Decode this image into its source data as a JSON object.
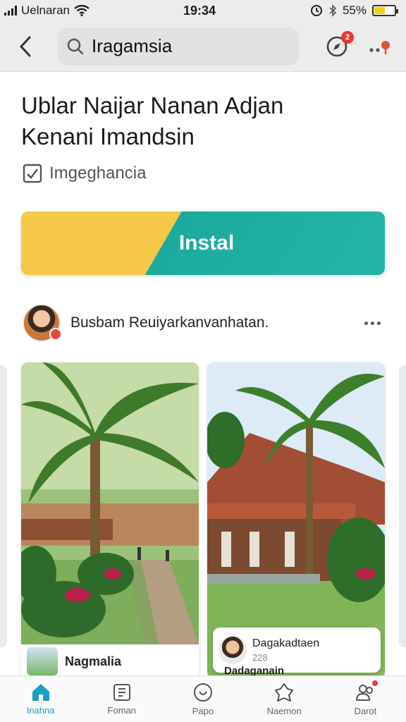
{
  "status_bar": {
    "carrier": "Uelnaran",
    "time": "19:34",
    "battery_percent": "55%",
    "battery_level": 0.55,
    "icons": [
      "signal-icon",
      "wifi-icon",
      "alarm-icon",
      "bluetooth-icon",
      "battery-icon"
    ]
  },
  "app_bar": {
    "search_text": "Iragamsia",
    "notification_badge": "2"
  },
  "header": {
    "title_line1": "Ublar Naijar Nanan Adjan",
    "title_line2": "Kenani Imandsin",
    "meta": "Imgeghancia"
  },
  "install": {
    "label": "Instal"
  },
  "author": {
    "name": "Busbam Reuiyarkanvanhatan."
  },
  "cards": [
    {
      "caption": "Nagmalia"
    },
    {
      "overlay_title": "Dagakadtaen",
      "overlay_sub": "228",
      "peek_text": "Dadaganain"
    }
  ],
  "bottom_nav": [
    {
      "label": "Inahna",
      "icon": "home-icon",
      "active": true
    },
    {
      "label": "Foman",
      "icon": "document-icon",
      "active": false
    },
    {
      "label": "Papo",
      "icon": "compass-icon",
      "active": false
    },
    {
      "label": "Naemon",
      "icon": "shield-icon",
      "active": false
    },
    {
      "label": "Darot",
      "icon": "people-icon",
      "active": false,
      "badge": true
    }
  ],
  "colors": {
    "accent": "#1c9fc0",
    "install_yellow": "#f5c84a",
    "install_teal": "#1aaa9e",
    "badge_red": "#e53935"
  }
}
